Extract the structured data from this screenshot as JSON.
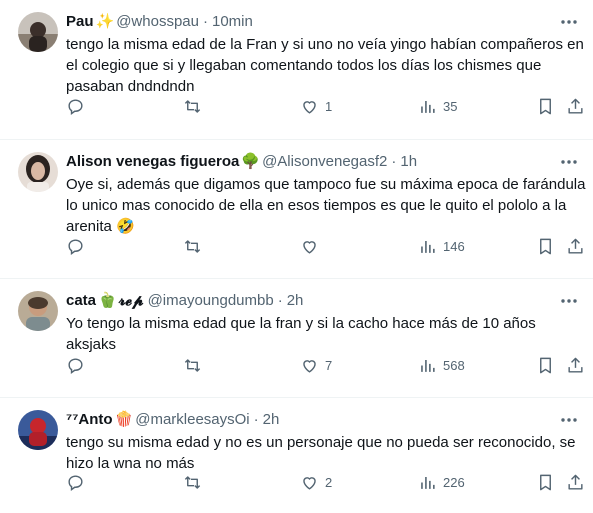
{
  "colors": {
    "text": "#0f1419",
    "muted": "#536471",
    "divider": "#eff3f4"
  },
  "tweets": [
    {
      "name": "Pau",
      "name_emoji": "✨",
      "handle": "@whosspau",
      "sep": "·",
      "time": "10min",
      "text": "tengo la misma edad de la Fran y si uno no veía yingo habían compañeros en el colegio que si y llegaban comentando todos los días los chismes que pasaban dndndndn",
      "likes": "1",
      "views": "35"
    },
    {
      "name": "Alison venegas figueroa",
      "name_emoji": "🌳",
      "handle": "@Alisonvenegasf2",
      "sep": "·",
      "time": "1h",
      "text": "Oye si, además que digamos que tampoco fue su máxima epoca de farándula lo unico mas conocido de ella en esos tiempos es que le quito el pololo a la arenita 🤣",
      "likes": "",
      "views": "146"
    },
    {
      "name": "cata",
      "name_emoji": "🫑",
      "name_suffix": "𝓻𝓮𝓹",
      "handle": "@imayoungdumbb",
      "sep": "·",
      "time": "2h",
      "text": "Yo tengo la misma edad que la fran y si la cacho hace más de 10 años aksjaks",
      "likes": "7",
      "views": "568"
    },
    {
      "name": "⁷⁷Anto",
      "name_emoji": "🍿",
      "handle": "@markleesaysOi",
      "sep": "·",
      "time": "2h",
      "text": "tengo su misma edad y no es un personaje que no pueda ser reconocido, se hizo la wna no más",
      "likes": "2",
      "views": "226"
    }
  ]
}
